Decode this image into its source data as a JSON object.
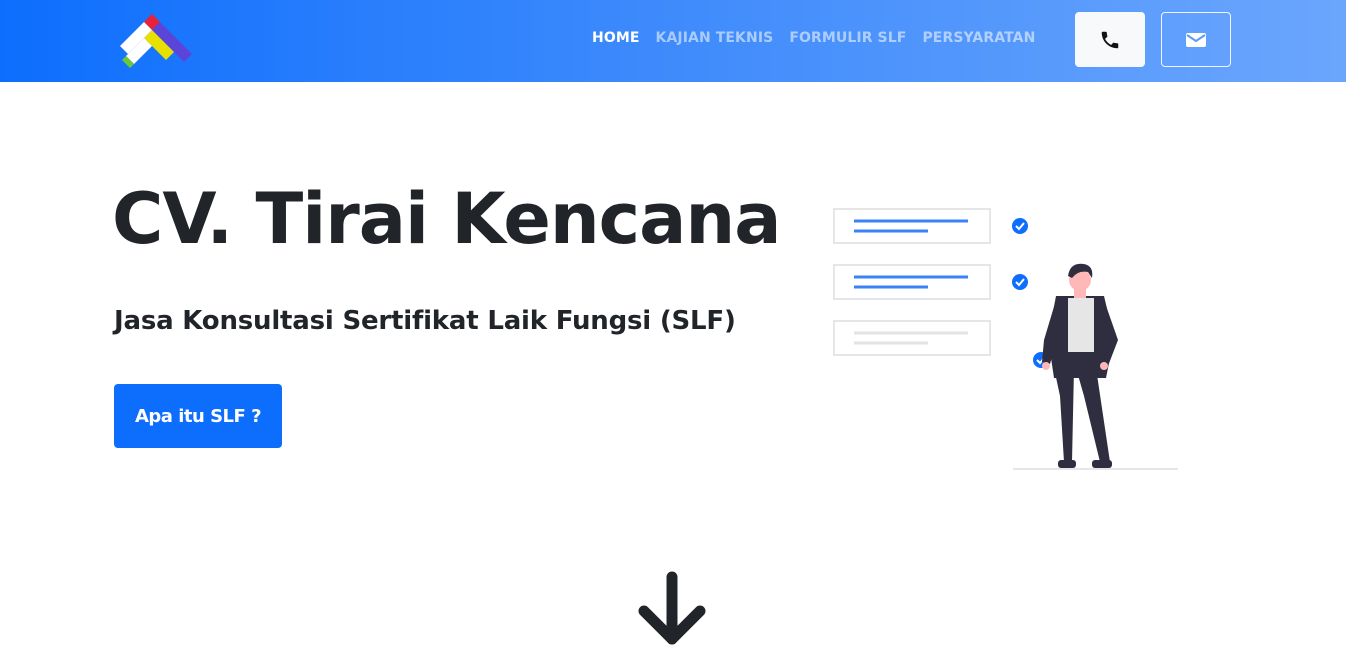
{
  "header": {
    "logo_icon": "brand-logo",
    "nav": [
      {
        "label": "HOME",
        "active": true
      },
      {
        "label": "KAJIAN TEKNIS",
        "active": false
      },
      {
        "label": "FORMULIR SLF",
        "active": false
      },
      {
        "label": "PERSYARATAN",
        "active": false
      }
    ],
    "phone_icon": "phone-icon",
    "mail_icon": "envelope-icon"
  },
  "hero": {
    "title": "CV. Tirai Kencana",
    "subtitle": "Jasa Konsultasi Sertifikat Laik Fungsi (SLF)",
    "cta_label": "Apa itu SLF ?",
    "illustration": "checklist-person-illustration"
  },
  "scroll_icon": "arrow-down-icon",
  "colors": {
    "primary": "#0d6efd",
    "navbar_gradient_start": "#0d6efd",
    "navbar_gradient_end": "#6ba6fd",
    "text_dark": "#212529"
  }
}
